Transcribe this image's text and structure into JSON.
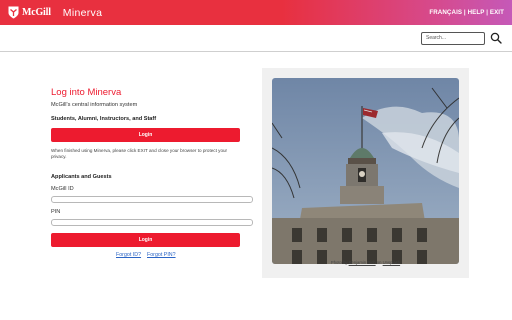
{
  "header": {
    "brand": "McGill",
    "app_name": "Minerva",
    "links": "FRANÇAIS | HELP | EXIT"
  },
  "search": {
    "placeholder": "Search..."
  },
  "login": {
    "title": "Log into Minerva",
    "subtitle": "McGill's central information system",
    "students_heading": "Students, Alumni, Instructors, and Staff",
    "login_button": "Login",
    "privacy_note": "When finished using Minerva, please click EXIT and close your browser to protect your privacy.",
    "applicants_heading": "Applicants and Guests",
    "mcgill_id_label": "McGill ID",
    "pin_label": "PIN",
    "login_button_2": "Login",
    "forgot_id": "Forgot ID?",
    "forgot_pin": "Forgot PIN?"
  },
  "photo": {
    "credit_prefix": "Photo by",
    "author": "Benjamin Rich",
    "credit_mid": "on",
    "source": "Unsplash"
  },
  "colors": {
    "accent": "#ed1b2f",
    "link": "#2a64c5"
  }
}
